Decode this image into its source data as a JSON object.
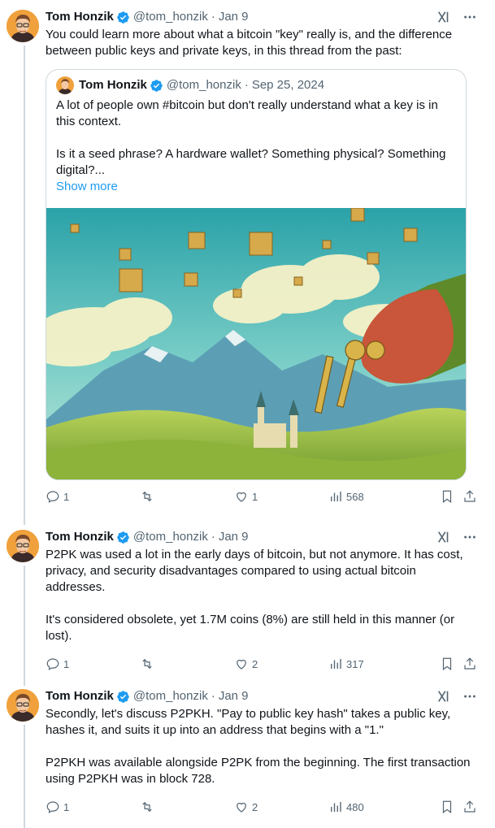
{
  "colors": {
    "accent": "#1d9bf0",
    "muted": "#536471",
    "text": "#0f1419",
    "border": "#cfd9de"
  },
  "tweets": [
    {
      "author": "Tom Honzik",
      "handle": "@tom_honzik",
      "date": "Jan 9",
      "text": "You could learn more about what a bitcoin \"key\" really is, and the difference between public keys and private keys, in this thread from the past:",
      "quote": {
        "author": "Tom Honzik",
        "handle": "@tom_honzik",
        "date": "Sep 25, 2024",
        "text": "A lot of people own #bitcoin but don't really understand what a key is in this context.\n\nIs it a seed phrase? A hardware wallet? Something physical? Something digital?...",
        "show_more": "Show more"
      },
      "replies": "1",
      "retweets": "",
      "likes": "1",
      "views": "568"
    },
    {
      "author": "Tom Honzik",
      "handle": "@tom_honzik",
      "date": "Jan 9",
      "text": "P2PK was used a lot in the early days of bitcoin, but not anymore. It has cost, privacy, and security disadvantages compared to using actual bitcoin addresses.\n\nIt's considered obsolete, yet 1.7M coins (8%) are still held in this manner (or lost).",
      "replies": "1",
      "retweets": "",
      "likes": "2",
      "views": "317"
    },
    {
      "author": "Tom Honzik",
      "handle": "@tom_honzik",
      "date": "Jan 9",
      "text": "Secondly, let's discuss P2PKH. \"Pay to public key hash\" takes a public key, hashes it, and suits it up into an address that begins with a \"1.\"\n\nP2PKH was available alongside P2PK from the beginning. The first transaction using P2PKH was in block 728.",
      "replies": "1",
      "retweets": "",
      "likes": "2",
      "views": "480"
    }
  ]
}
